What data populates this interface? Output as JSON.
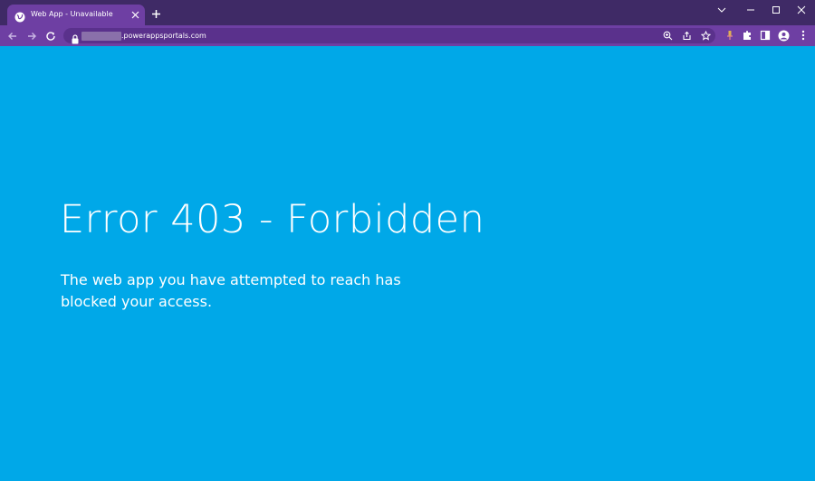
{
  "browser": {
    "tab": {
      "title": "Web App - Unavailable"
    },
    "address_bar": {
      "url_visible": ".powerappsportals.com"
    }
  },
  "page": {
    "title": "Error 403 - Forbidden",
    "message": "The web app you have attempted to reach has blocked your access."
  },
  "colors": {
    "titlebar": "#3f2a66",
    "toolbar": "#6e3fa3",
    "page_background": "#00a8e8",
    "text": "#ffffff"
  },
  "icons": {
    "tab_favicon": "globe-icon",
    "tab_close": "close-icon",
    "new_tab": "plus-icon",
    "back": "arrow-left-icon",
    "forward": "arrow-right-icon",
    "reload": "reload-icon",
    "lock": "lock-icon",
    "zoom": "zoom-icon",
    "share": "share-icon",
    "bookmark": "star-icon",
    "extension": "puzzle-icon",
    "side_panel": "side-panel-icon",
    "profile": "profile-icon",
    "menu": "kebab-menu-icon"
  }
}
